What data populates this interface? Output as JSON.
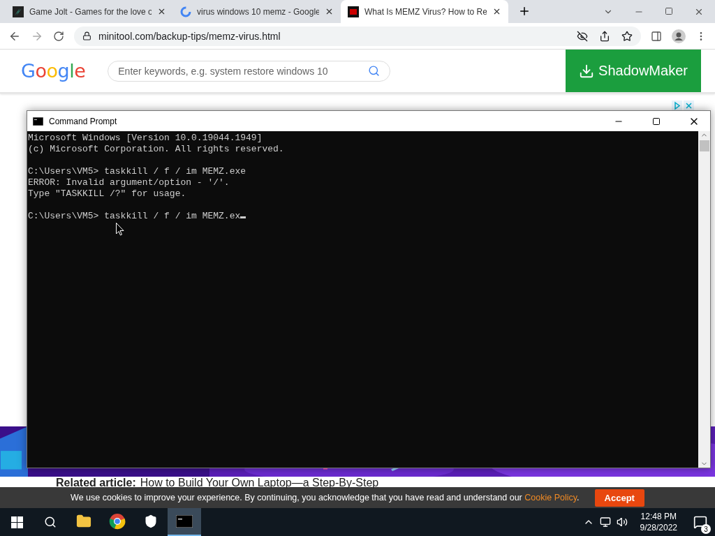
{
  "browser": {
    "tabs": [
      {
        "title": "Game Jolt - Games for the love o",
        "kind": "gamejolt",
        "selected": false
      },
      {
        "title": "virus windows 10 memz - Google",
        "kind": "google",
        "selected": false
      },
      {
        "title": "What Is MEMZ Virus? How to Re",
        "kind": "minitool",
        "selected": true
      }
    ],
    "url": "minitool.com/backup-tips/memz-virus.html"
  },
  "page": {
    "logo": [
      {
        "ch": "G",
        "color": "#4285f4"
      },
      {
        "ch": "o",
        "color": "#ea4335"
      },
      {
        "ch": "o",
        "color": "#fbbc05"
      },
      {
        "ch": "g",
        "color": "#4285f4"
      },
      {
        "ch": "l",
        "color": "#34a853"
      },
      {
        "ch": "e",
        "color": "#ea4335"
      }
    ],
    "search": {
      "placeholder": "Enter keywords, e.g. system restore windows 10"
    },
    "download_button": "ShadowMaker",
    "related_label": "Related article:",
    "related_link": "How to Build Your Own Laptop—a Step-By-Step",
    "cookie": {
      "text": "We use cookies to improve your experience. By continuing, you acknowledge that you have read and understand our",
      "link": "Cookie Policy",
      "end": ".",
      "button": "Accept"
    }
  },
  "console": {
    "title": "Command Prompt",
    "blocks": [
      [
        "Microsoft Windows [Version 10.0.19044.1949]",
        "(c) Microsoft Corporation. All rights reserved."
      ],
      [
        "C:\\Users\\VM5> taskkill / f / im MEMZ.exe",
        "ERROR: Invalid argument/option - '/'.",
        "Type \"TASKKILL /?\" for usage."
      ],
      [
        "C:\\Users\\VM5> taskkill / f / im MEMZ.ex"
      ]
    ]
  },
  "taskbar": {
    "apps": [
      {
        "kind": "explorer",
        "active": false
      },
      {
        "kind": "chrome",
        "active": false
      },
      {
        "kind": "security",
        "active": false
      },
      {
        "kind": "terminal",
        "active": true
      }
    ],
    "time": "12:48 PM",
    "date": "9/28/2022",
    "notifications": "3"
  }
}
